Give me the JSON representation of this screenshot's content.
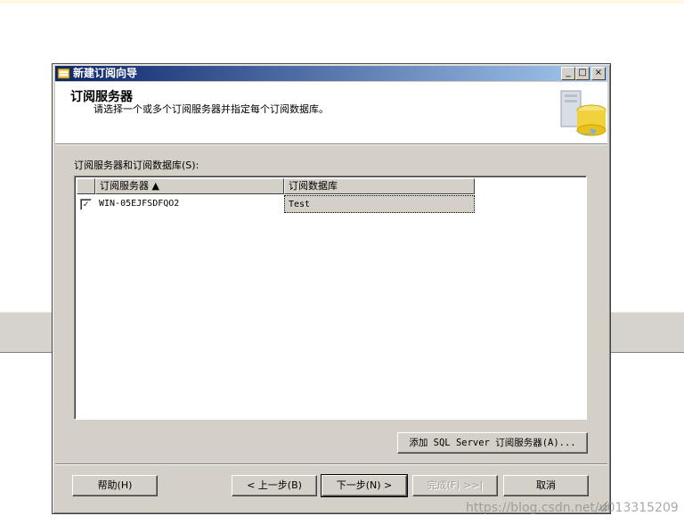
{
  "window": {
    "title": "新建订阅向导",
    "controls": {
      "minimize": "_",
      "maximize": "□",
      "close": "×"
    }
  },
  "header": {
    "title": "订阅服务器",
    "subtitle": "请选择一个或多个订阅服务器并指定每个订阅数据库。"
  },
  "list": {
    "label": "订阅服务器和订阅数据库(S):",
    "columns": [
      "订阅服务器 ▲",
      "订阅数据库"
    ],
    "rows": [
      {
        "checked": true,
        "check_mark": "✓",
        "server": "WIN-05EJFSDFQO2",
        "database": "Test"
      }
    ]
  },
  "buttons": {
    "add_subscriber": "添加 SQL Server 订阅服务器(A)...",
    "help": "帮助(H)",
    "back": "< 上一步(B)",
    "next": "下一步(N) >",
    "finish": "完成(F) >>|",
    "cancel": "取消"
  },
  "watermark": "https://blog.csdn.net/u013315209",
  "colors": {
    "title_start": "#0a246a",
    "title_end": "#a6caf0",
    "dialog_bg": "#d4d0c8"
  }
}
